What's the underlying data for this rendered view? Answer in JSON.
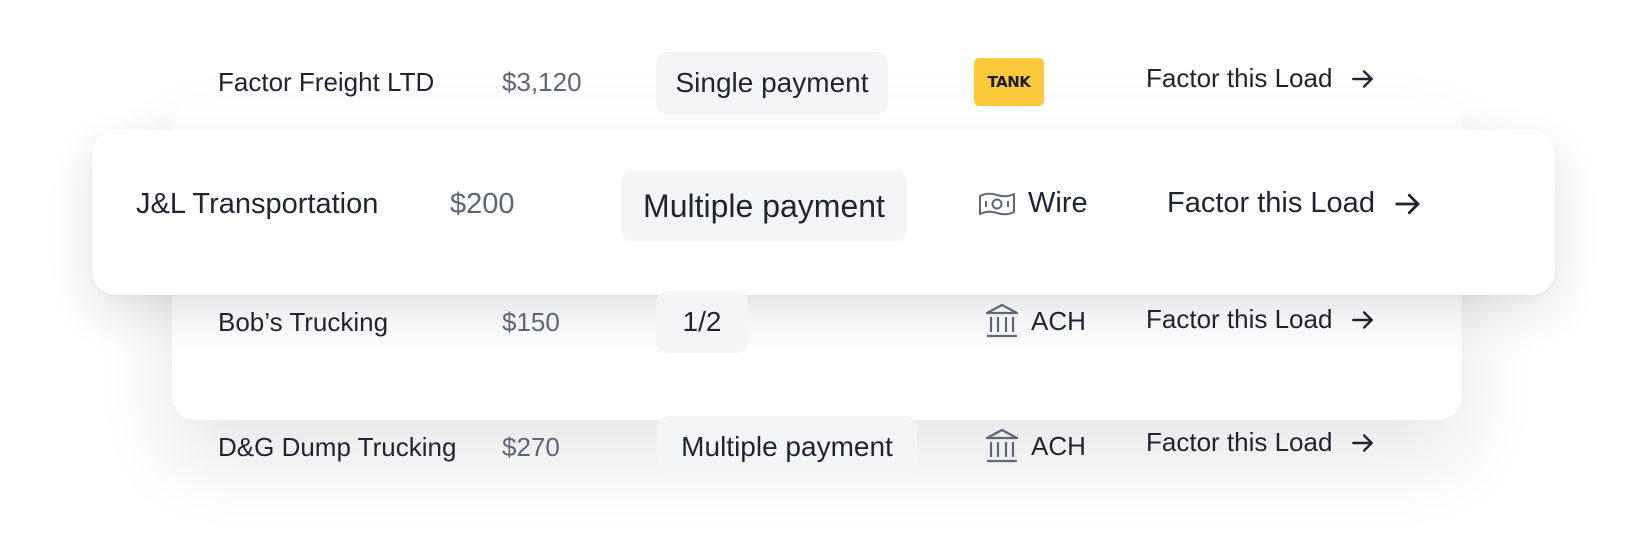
{
  "loads": [
    {
      "company": "Factor Freight LTD",
      "amount": "$3,120",
      "payment_type": "Single payment",
      "method_label": "TANK",
      "method_icon": "tank-logo",
      "action_label": "Factor this Load",
      "action_icon": "arrow-right-icon"
    },
    {
      "company": "J&L Transportation",
      "amount": "$200",
      "payment_type": "Multiple payment",
      "method_label": "Wire",
      "method_icon": "banknote-icon",
      "action_label": "Factor this Load",
      "action_icon": "arrow-right-icon",
      "highlighted": true
    },
    {
      "company": "Bob’s Trucking",
      "amount": "$150",
      "payment_type": "1/2",
      "method_label": "ACH",
      "method_icon": "bank-icon",
      "action_label": "Factor this Load",
      "action_icon": "arrow-right-icon"
    },
    {
      "company": "D&G Dump Trucking",
      "amount": "$270",
      "payment_type": "Multiple payment",
      "method_label": "ACH",
      "method_icon": "bank-icon",
      "action_label": "Factor this Load",
      "action_icon": "arrow-right-icon"
    }
  ],
  "colors": {
    "text_primary": "#1f2430",
    "text_secondary": "#5f6675",
    "pill_background": "#f4f5f6",
    "tank_badge": "#fcc93a",
    "icon_gray": "#5f6675"
  }
}
